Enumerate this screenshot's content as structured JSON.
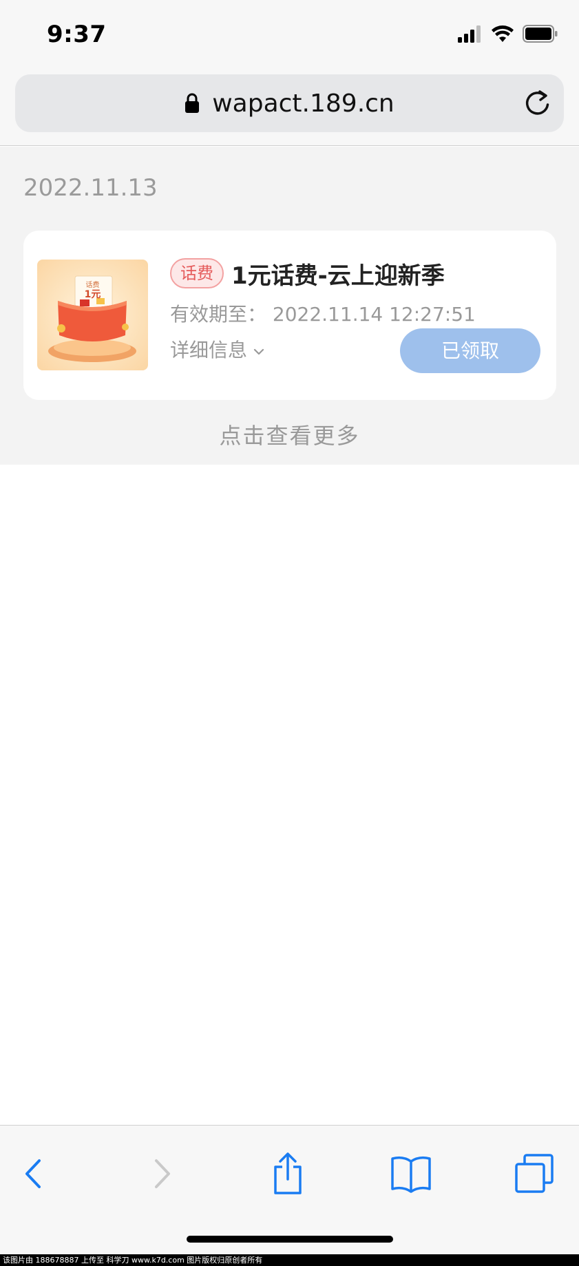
{
  "status_bar": {
    "time": "9:37",
    "icons": [
      "signal-icon",
      "wifi-icon",
      "battery-icon"
    ]
  },
  "browser": {
    "url": "wapact.189.cn",
    "icons": [
      "lock-icon",
      "reload-icon"
    ]
  },
  "content": {
    "date": "2022.11.13",
    "card": {
      "tag": "话费",
      "title": "1元话费-云上迎新季",
      "validity": "有效期至：  2022.11.14 12:27:51",
      "details_label": "详细信息",
      "button_label": "已领取",
      "thumbnail": {
        "top_text": "话费",
        "amount_text": "1元"
      }
    },
    "see_more": "点击查看更多"
  },
  "toolbar": {
    "icons": [
      "back-icon",
      "forward-icon",
      "share-icon",
      "bookmarks-icon",
      "tabs-icon"
    ]
  },
  "watermark": "该图片由 188678887 上传至 科学刀 www.k7d.com 图片版权归原创者所有",
  "colors": {
    "accent_blue": "#1a7cf2",
    "button_blue": "#9ec0ec",
    "tag_red": "#e55b5b",
    "content_bg": "#f3f3f3"
  }
}
